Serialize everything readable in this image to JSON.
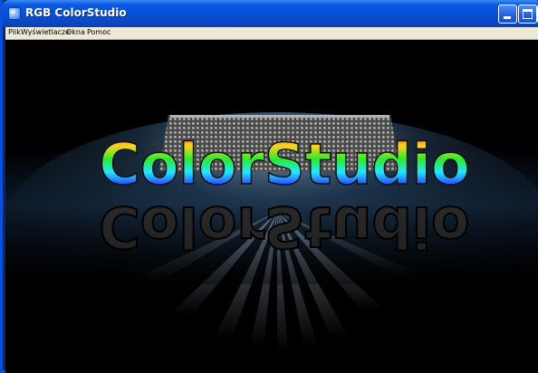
{
  "window": {
    "title": "RGB ColorStudio",
    "app_icon": "colorstudio-app-icon",
    "controls": [
      "minimize-icon",
      "maximize-icon",
      "close-icon"
    ],
    "title_bar_color": "#0a58e0"
  },
  "menubar": {
    "items": [
      {
        "label": "Plik"
      },
      {
        "label": "Wyświetlacze"
      },
      {
        "label": "Okna"
      },
      {
        "label": "Pomoc"
      }
    ]
  },
  "splash": {
    "logo_text": "ColorStudio",
    "background": "#000000"
  }
}
